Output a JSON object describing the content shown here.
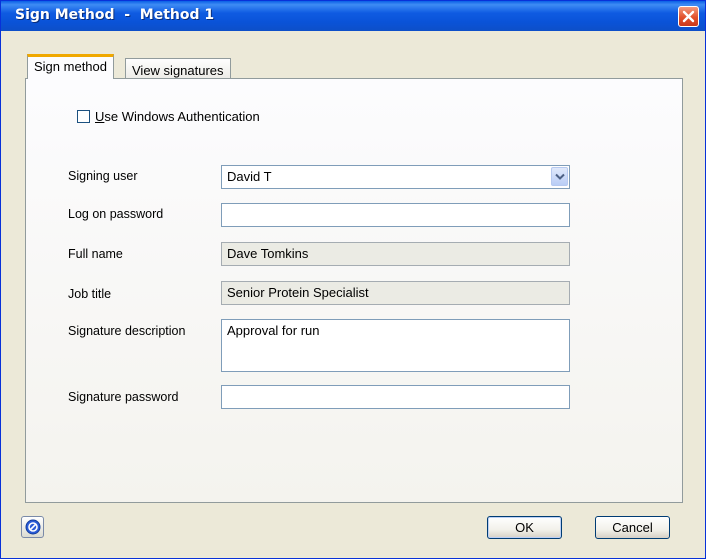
{
  "window": {
    "title": "Sign Method  -  Method 1",
    "close_icon": "close-x-icon"
  },
  "tabs": [
    {
      "label": "Sign method",
      "active": true
    },
    {
      "label": "View signatures",
      "active": false
    }
  ],
  "windows_auth": {
    "label_accel": "U",
    "label_rest": "se Windows Authentication",
    "checked": false
  },
  "form": {
    "signing_user": {
      "label": "Signing user",
      "value": "David T"
    },
    "logon_password": {
      "label": "Log on password",
      "value": ""
    },
    "full_name": {
      "label": "Full name",
      "value": "Dave Tomkins"
    },
    "job_title": {
      "label": "Job title",
      "value": "Senior Protein Specialist"
    },
    "signature_description": {
      "label": "Signature description",
      "value": "Approval for run"
    },
    "signature_password": {
      "label": "Signature password",
      "value": ""
    }
  },
  "footer": {
    "help_icon": "help-icon",
    "ok_label": "OK",
    "cancel_label": "Cancel"
  },
  "colors": {
    "titlebar": "#0a53d8",
    "dialog_bg": "#ece9d8",
    "active_tab_accent": "#f0a800",
    "close_button": "#e2512c"
  }
}
